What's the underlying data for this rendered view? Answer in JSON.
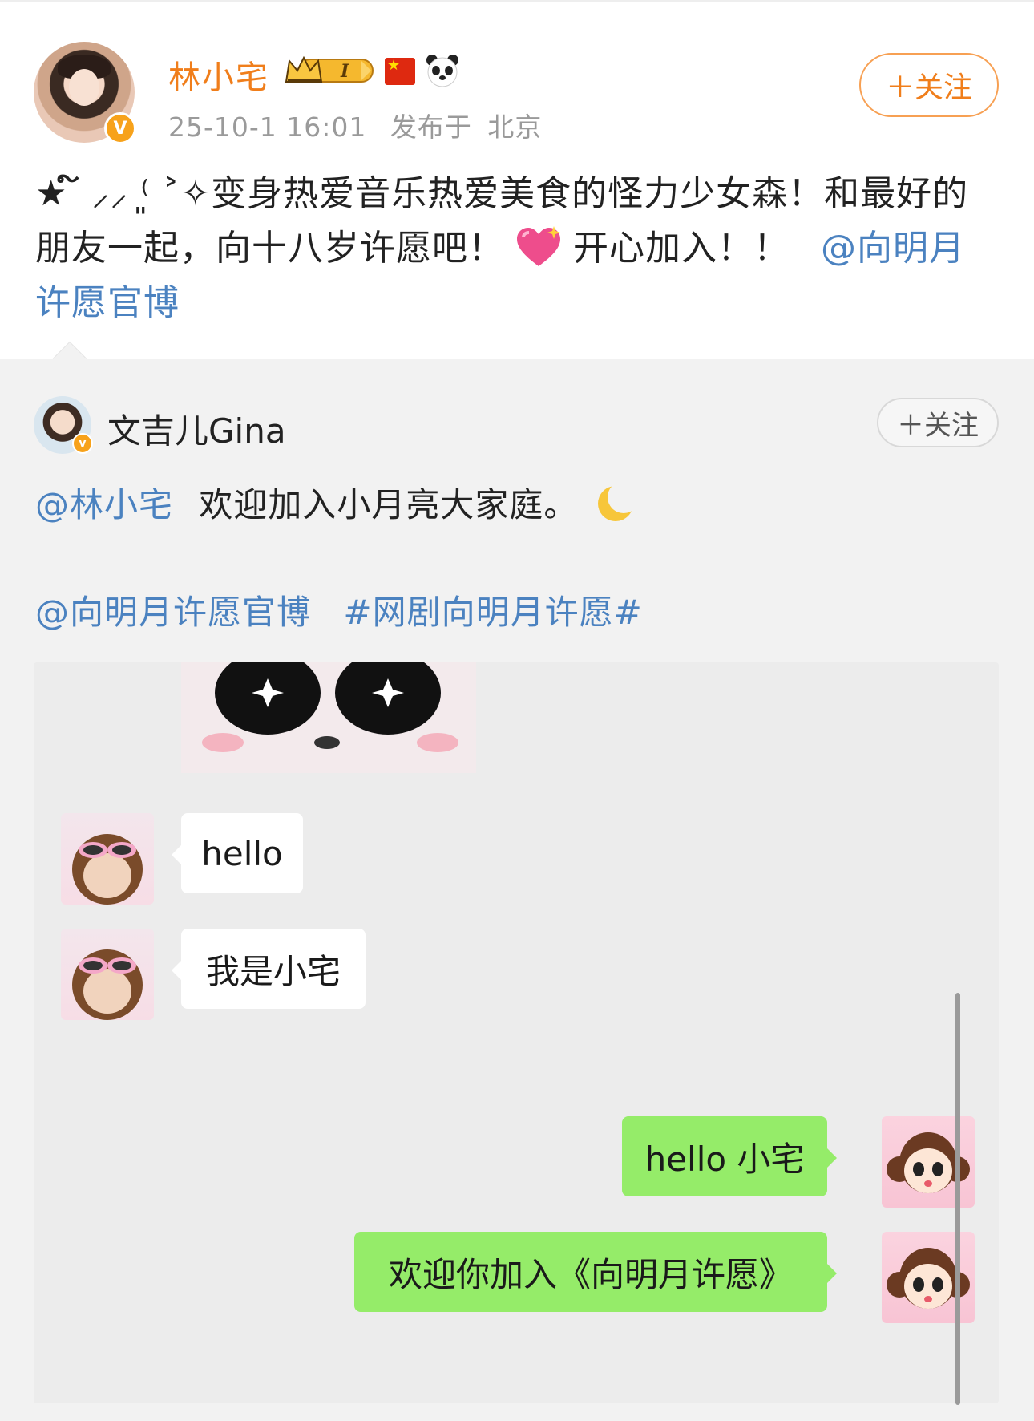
{
  "post": {
    "username": "林小宅",
    "timestamp": "25-10-1 16:01",
    "location_prefix": "发布于",
    "location": "北京",
    "follow_label": "＋关注",
    "text_main": "★ ໌ ⸝⸝ ⁽͈ ˃✧变身热爱音乐热爱美食的怪力少女森！和最好的朋友一起，向十八岁许愿吧！",
    "text_tail": "开心加入！！",
    "mention": "@向明月许愿官博"
  },
  "repost": {
    "username": "文吉儿Gina",
    "follow_label": "＋关注",
    "mention_user": "@林小宅",
    "line1_text": "欢迎加入小月亮大家庭。",
    "mention_official": "@向明月许愿官博",
    "hashtag": "#网剧向明月许愿#"
  },
  "chat": {
    "messages": [
      {
        "side": "left",
        "text": "hello"
      },
      {
        "side": "left",
        "text": "我是小宅"
      },
      {
        "side": "right",
        "text": "hello 小宅"
      },
      {
        "side": "right",
        "text": "欢迎你加入《向明月许愿》"
      }
    ]
  },
  "icons": {
    "verified": "verified-badge-icon",
    "crown": "crown-level-badge-icon",
    "flag": "china-flag-icon",
    "panda": "panda-icon",
    "heart": "sparkling-heart-icon",
    "moon": "crescent-moon-icon"
  },
  "colors": {
    "username_orange": "#f07e1b",
    "link_blue": "#4b82c0",
    "bubble_green": "#95ec69",
    "repost_bg": "#f2f2f2"
  }
}
